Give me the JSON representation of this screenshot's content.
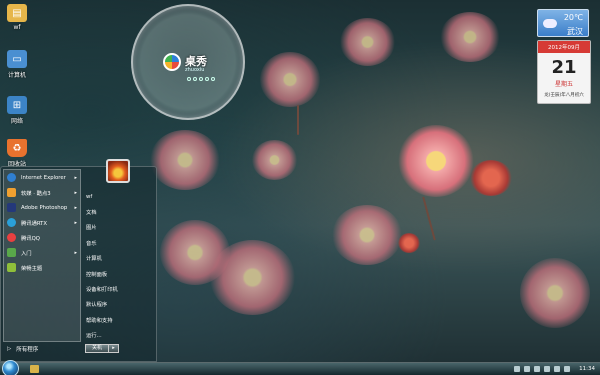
{
  "desktop_icons": [
    {
      "label": "wf",
      "icon": "user-folder-icon",
      "color": "#e6b64a"
    },
    {
      "label": "计算机",
      "icon": "computer-icon",
      "color": "#4a8fd1"
    },
    {
      "label": "网络",
      "icon": "network-icon",
      "color": "#3c84c6"
    },
    {
      "label": "回收站",
      "icon": "recycle-bin-icon",
      "color": "#e8722e"
    }
  ],
  "clock_gadget": {
    "title": "桌秀",
    "subtitle": "zhuoxiu"
  },
  "weather": {
    "temp": "20℃",
    "city": "武汉"
  },
  "calendar": {
    "month": "2012年09月",
    "day": "21",
    "weekday": "星期五",
    "lunar": "龙(壬辰)年八月初六"
  },
  "start_menu": {
    "programs": [
      {
        "label": "Internet Explorer",
        "icon": "internet-explorer-icon",
        "color": "#2f7fd0",
        "arrow": "▸"
      },
      {
        "label": "软媒 · 酷点3",
        "icon": "kudian-icon",
        "color": "#f0a030",
        "arrow": "▸"
      },
      {
        "label": "Adobe Photoshop",
        "icon": "photoshop-icon",
        "color": "#24387a",
        "arrow": "▸"
      },
      {
        "label": "腾讯通RTX",
        "icon": "rtx-icon",
        "color": "#2aa0d8",
        "arrow": "▸"
      },
      {
        "label": "腾讯QQ",
        "icon": "qq-icon",
        "color": "#e84040",
        "arrow": ""
      },
      {
        "label": "入门",
        "icon": "getting-started-icon",
        "color": "#59a84a",
        "arrow": "▸"
      },
      {
        "label": "荣畅主题",
        "icon": "theme-icon",
        "color": "#8fbf3a",
        "arrow": ""
      }
    ],
    "all_programs": "所有程序",
    "right_items": [
      "wf",
      "文档",
      "图片",
      "音乐",
      "计算机",
      "控制面板",
      "设备和打印机",
      "默认程序",
      "帮助和支持",
      "运行..."
    ],
    "shutdown": "关机"
  },
  "taskbar": {
    "time": "11:34"
  }
}
